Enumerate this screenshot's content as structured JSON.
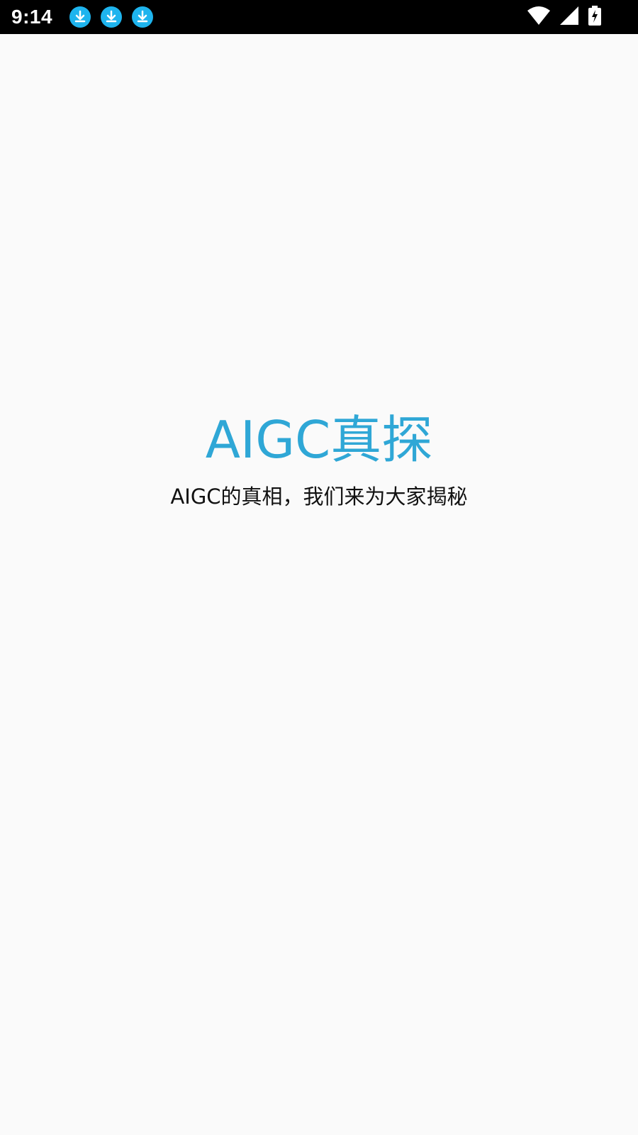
{
  "status_bar": {
    "time": "9:14",
    "notifications": [
      {
        "icon": "download-icon"
      },
      {
        "icon": "download-icon"
      },
      {
        "icon": "download-icon"
      }
    ],
    "system_icons": [
      "wifi-icon",
      "cell-signal-icon",
      "battery-charging-icon"
    ]
  },
  "splash": {
    "title": "AIGC真探",
    "subtitle": "AIGC的真相，我们来为大家揭秘"
  },
  "colors": {
    "background": "#fafafa",
    "status_bar": "#000000",
    "title": "#2fa7d6",
    "subtitle": "#111111",
    "notification_icon": "#1eb4ee"
  }
}
